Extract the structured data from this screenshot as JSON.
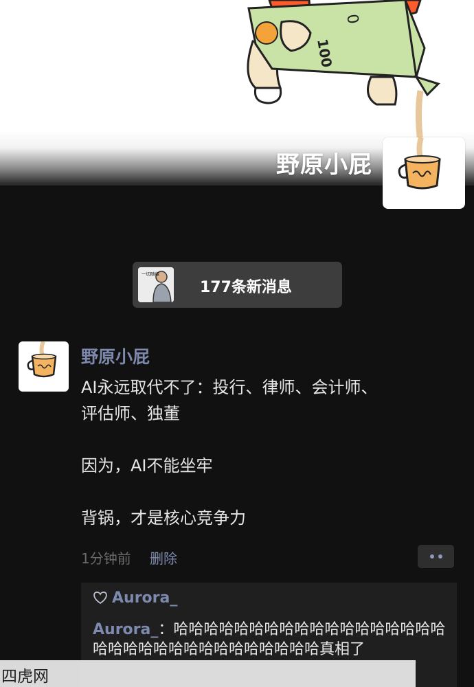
{
  "cover": {
    "name": "野原小屁",
    "carton_text_top": "0",
    "carton_text_side": "100"
  },
  "notification": {
    "new_messages": "177条新消息",
    "avatar_caption": "一切随缘"
  },
  "post": {
    "author": "野原小屁",
    "lines": [
      "AI永远取代不了：投行、律师、会计师、",
      "评估师、独董",
      "",
      "因为，AI不能坐牢",
      "",
      "背锅，才是核心竞争力"
    ],
    "time": "1分钟前",
    "delete_label": "删除"
  },
  "likes": {
    "users": "Aurora_"
  },
  "comments": [
    {
      "author": "Aurora_",
      "separator": "：",
      "text": "哈哈哈哈哈哈哈哈哈哈哈哈哈哈哈哈哈哈哈哈哈哈哈哈哈哈哈哈哈哈哈哈哈真相了"
    }
  ],
  "watermark": "四虎网",
  "colors": {
    "background": "#111111",
    "link_blue": "#7d89ad",
    "body_text": "#e6e6e6",
    "muted": "#6b6b6b",
    "carton_green": "#c9e3a6",
    "sleeve_orange": "#ff5a2c",
    "cup_orange": "#f4b45f"
  }
}
